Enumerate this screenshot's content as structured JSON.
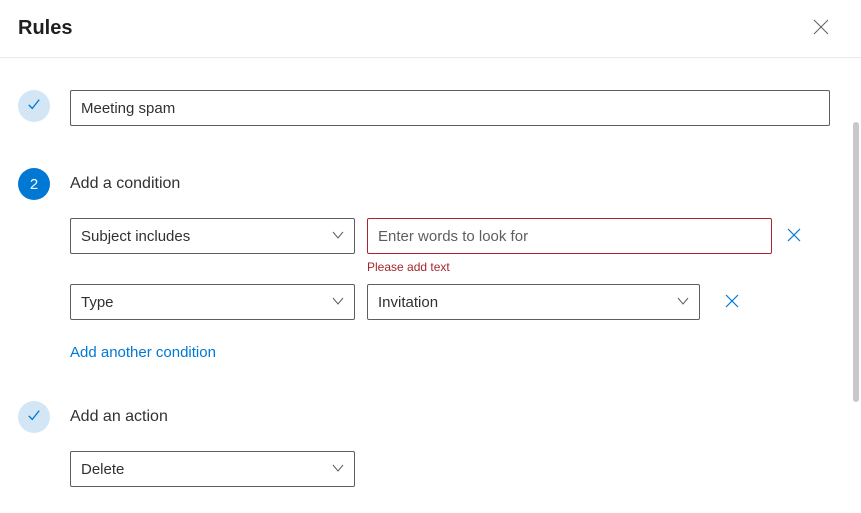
{
  "header": {
    "title": "Rules"
  },
  "step1": {
    "badge": "done",
    "name_value": "Meeting spam"
  },
  "step2": {
    "badge_label": "2",
    "title": "Add a condition",
    "cond1": {
      "selector_label": "Subject includes",
      "input_value": "",
      "input_placeholder": "Enter words to look for",
      "error": "Please add text"
    },
    "cond2": {
      "selector_label": "Type",
      "value_label": "Invitation"
    },
    "add_link": "Add another condition"
  },
  "step3": {
    "badge": "done",
    "title": "Add an action",
    "action_label": "Delete"
  }
}
